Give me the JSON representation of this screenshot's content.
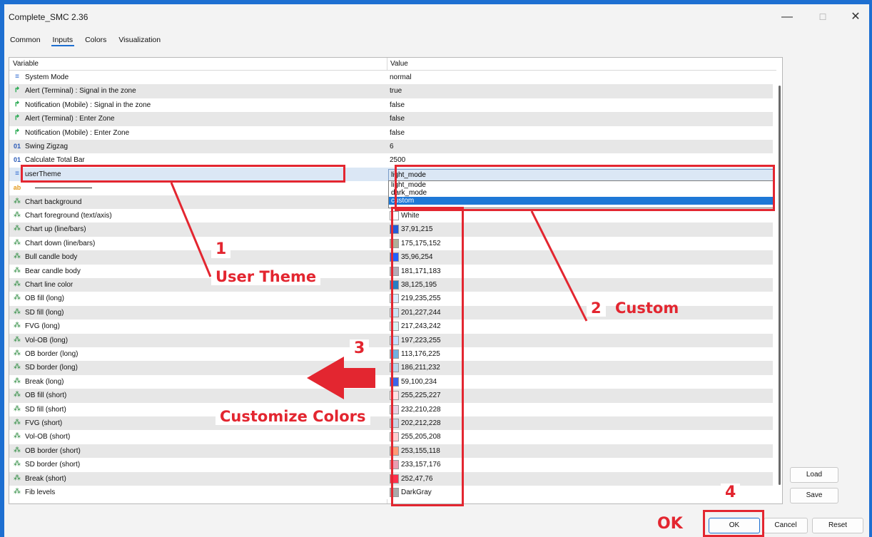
{
  "window": {
    "title": "Complete_SMC 2.36",
    "minimize": "—",
    "maximize": "☐",
    "close": "✕"
  },
  "tabs": [
    "Common",
    "Inputs",
    "Colors",
    "Visualization"
  ],
  "table": {
    "col_variable": "Variable",
    "col_value": "Value",
    "rows": [
      {
        "icon": "dropdown",
        "name": "System Mode",
        "value": "normal"
      },
      {
        "icon": "arrow",
        "name": "Alert (Terminal) : Signal in the zone",
        "value": "true"
      },
      {
        "icon": "arrow",
        "name": "Notification (Mobile) : Signal in the zone",
        "value": "false"
      },
      {
        "icon": "arrow",
        "name": "Alert (Terminal) : Enter Zone",
        "value": "false"
      },
      {
        "icon": "arrow",
        "name": "Notification (Mobile) : Enter Zone",
        "value": "false"
      },
      {
        "icon": "number",
        "name": "Swing Zigzag",
        "value": "6"
      },
      {
        "icon": "number",
        "name": "Calculate Total Bar",
        "value": "2500"
      },
      {
        "icon": "dropdown",
        "name": "userTheme",
        "value": "light_mode"
      },
      {
        "icon": "string",
        "name": "",
        "value": ""
      },
      {
        "icon": "color",
        "name": "Chart background",
        "value": ""
      },
      {
        "icon": "color",
        "name": "Chart foreground (text/axis)",
        "value": "White",
        "swatch": "#ffffff"
      },
      {
        "icon": "color",
        "name": "Chart up (line/bars)",
        "value": "37,91,215",
        "swatch": "#255bd7"
      },
      {
        "icon": "color",
        "name": "Chart down (line/bars)",
        "value": "175,175,152",
        "swatch": "#afaf98"
      },
      {
        "icon": "color",
        "name": "Bull candle body",
        "value": "35,96,254",
        "swatch": "#2360fe"
      },
      {
        "icon": "color",
        "name": "Bear candle body",
        "value": "181,171,183",
        "swatch": "#b5abb7"
      },
      {
        "icon": "color",
        "name": "Chart line color",
        "value": "38,125,195",
        "swatch": "#267dc3"
      },
      {
        "icon": "color",
        "name": "OB fill (long)",
        "value": "219,235,255",
        "swatch": "#dbebff"
      },
      {
        "icon": "color",
        "name": "SD fill (long)",
        "value": "201,227,244",
        "swatch": "#c9e3f4"
      },
      {
        "icon": "color",
        "name": "FVG (long)",
        "value": "217,243,242",
        "swatch": "#d9f3f2"
      },
      {
        "icon": "color",
        "name": "Vol-OB (long)",
        "value": "197,223,255",
        "swatch": "#c5dfff"
      },
      {
        "icon": "color",
        "name": "OB border (long)",
        "value": "113,176,225",
        "swatch": "#71b0e1"
      },
      {
        "icon": "color",
        "name": "SD border (long)",
        "value": "186,211,232",
        "swatch": "#bad3e8"
      },
      {
        "icon": "color",
        "name": "Break (long)",
        "value": "59,100,234",
        "swatch": "#3b64ea"
      },
      {
        "icon": "color",
        "name": "OB fill (short)",
        "value": "255,225,227",
        "swatch": "#ffe1e3"
      },
      {
        "icon": "color",
        "name": "SD fill (short)",
        "value": "232,210,228",
        "swatch": "#e8d2e4"
      },
      {
        "icon": "color",
        "name": "FVG (short)",
        "value": "202,212,228",
        "swatch": "#cad4e4"
      },
      {
        "icon": "color",
        "name": "Vol-OB (short)",
        "value": "255,205,208",
        "swatch": "#ffcdd0"
      },
      {
        "icon": "color",
        "name": "OB border (short)",
        "value": "253,155,118",
        "swatch": "#fd9b76"
      },
      {
        "icon": "color",
        "name": "SD border (short)",
        "value": "233,157,176",
        "swatch": "#e99db0"
      },
      {
        "icon": "color",
        "name": "Break (short)",
        "value": "252,47,76",
        "swatch": "#fc2f4c"
      },
      {
        "icon": "color",
        "name": "Fib levels",
        "value": "DarkGray",
        "swatch": "#a9a9a9"
      }
    ]
  },
  "dropdown": {
    "selected": "light_mode",
    "options": [
      "light_mode",
      "dark_mode",
      "custom"
    ],
    "highlighted": "custom"
  },
  "buttons": {
    "load": "Load",
    "save": "Save",
    "ok": "OK",
    "cancel": "Cancel",
    "reset": "Reset"
  },
  "annotations": {
    "n1": "1",
    "label1": "User Theme",
    "n2": "2",
    "label2": "Custom",
    "n3": "3",
    "label3": "Customize Colors",
    "n4": "4",
    "ok_label": "OK"
  },
  "colors": {
    "annotation_red": "#e32630",
    "accent_blue": "#1d6fd1",
    "highlight_blue": "#1e78d6"
  }
}
